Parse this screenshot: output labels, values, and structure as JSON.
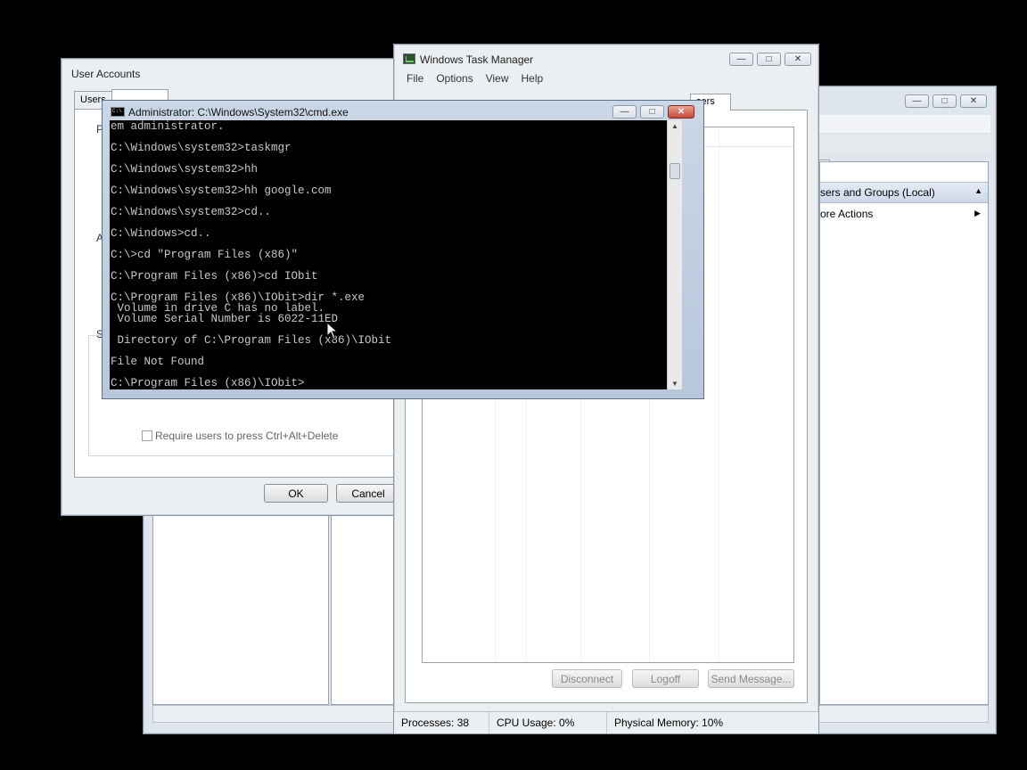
{
  "mmc": {
    "actions_header": "sers and Groups (Local)",
    "more_actions": "ore Actions"
  },
  "user_accounts": {
    "title": "User Accounts",
    "tab_users": "Users",
    "frag_p": "P",
    "frag_a": "A",
    "frag_s": "S",
    "require_ctrl_alt_del": "Require users to press Ctrl+Alt+Delete",
    "ok": "OK",
    "cancel": "Cancel"
  },
  "task_manager": {
    "title": "Windows Task Manager",
    "menu": [
      "File",
      "Options",
      "View",
      "Help"
    ],
    "tab_users": "sers",
    "disconnect": "Disconnect",
    "logoff": "Logoff",
    "send_message": "Send Message...",
    "processes": "Processes: 38",
    "cpu": "CPU Usage: 0%",
    "memory": "Physical Memory: 10%"
  },
  "cmd": {
    "title": "Administrator: C:\\Windows\\System32\\cmd.exe",
    "icon_text": "C:\\",
    "lines": [
      "em administrator.",
      "",
      "C:\\Windows\\system32>taskmgr",
      "",
      "C:\\Windows\\system32>hh",
      "",
      "C:\\Windows\\system32>hh google.com",
      "",
      "C:\\Windows\\system32>cd..",
      "",
      "C:\\Windows>cd..",
      "",
      "C:\\>cd \"Program Files (x86)\"",
      "",
      "C:\\Program Files (x86)>cd IObit",
      "",
      "C:\\Program Files (x86)\\IObit>dir *.exe",
      " Volume in drive C has no label.",
      " Volume Serial Number is 6022-11ED",
      "",
      " Directory of C:\\Program Files (x86)\\IObit",
      "",
      "File Not Found",
      "",
      "C:\\Program Files (x86)\\IObit>"
    ]
  }
}
